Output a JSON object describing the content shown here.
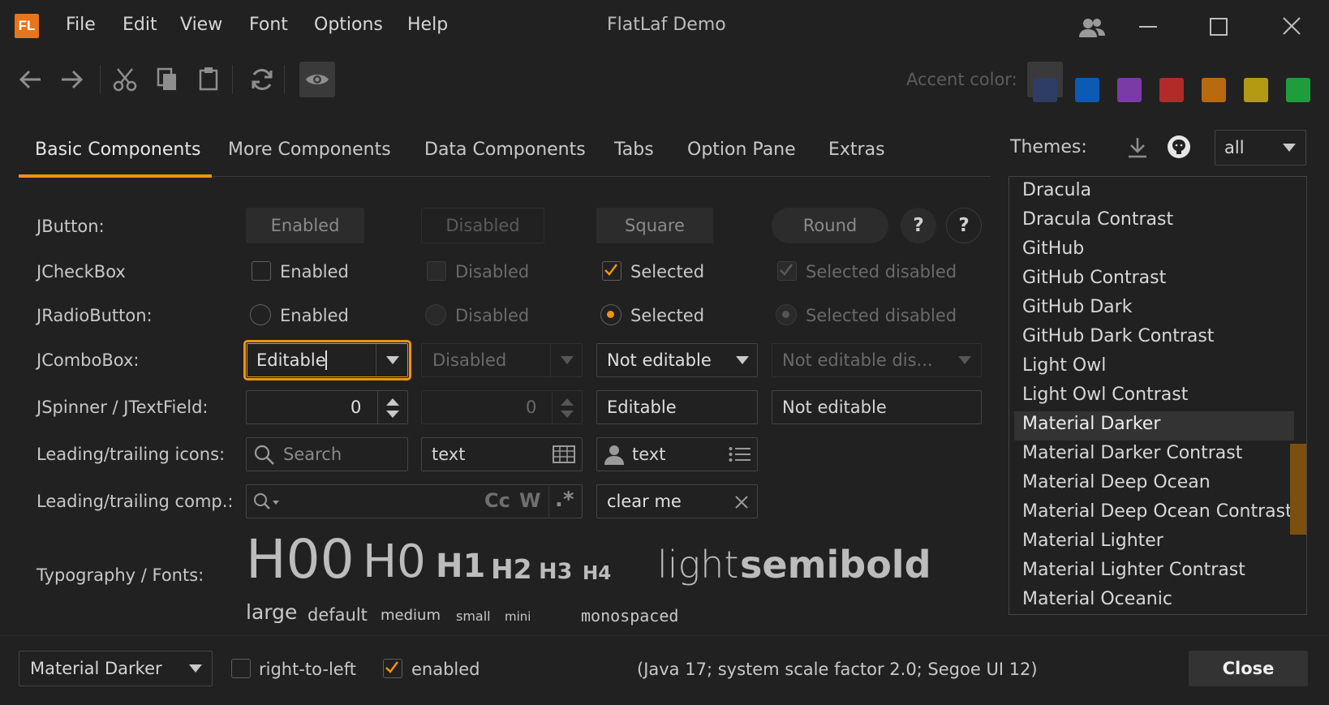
{
  "title_bar": {
    "app_title": "FlatLaf Demo",
    "logo_text": "FL"
  },
  "menu": {
    "file": "File",
    "edit": "Edit",
    "view": "View",
    "font": "Font",
    "options": "Options",
    "help": "Help"
  },
  "toolbar": {
    "accent_label": "Accent color:",
    "accent_colors": [
      "#2e3d63",
      "#0b5bb5",
      "#7b3ba6",
      "#b22a2a",
      "#b86a10",
      "#b39a13",
      "#1f9d3c"
    ]
  },
  "tabs": [
    "Basic Components",
    "More Components",
    "Data Components",
    "Tabs",
    "Option Pane",
    "Extras"
  ],
  "rows": {
    "jbutton": {
      "label": "JButton:",
      "enabled": "Enabled",
      "disabled": "Disabled",
      "square": "Square",
      "round": "Round",
      "help": "?"
    },
    "jcheckbox": {
      "label": "JCheckBox",
      "enabled": "Enabled",
      "disabled": "Disabled",
      "selected": "Selected",
      "selected_disabled": "Selected disabled"
    },
    "jradio": {
      "label": "JRadioButton:",
      "enabled": "Enabled",
      "disabled": "Disabled",
      "selected": "Selected",
      "selected_disabled": "Selected disabled"
    },
    "jcombo": {
      "label": "JComboBox:",
      "editable": "Editable",
      "disabled": "Disabled",
      "not_editable": "Not editable",
      "not_editable_dis": "Not editable dis..."
    },
    "jspinner": {
      "label": "JSpinner / JTextField:",
      "value": "0",
      "value_disabled": "0",
      "editable": "Editable",
      "not_editable": "Not editable"
    },
    "icons": {
      "label": "Leading/trailing icons:",
      "search_placeholder": "Search",
      "text1": "text",
      "text2": "text"
    },
    "comps": {
      "label": "Leading/trailing comp.:",
      "cc": "Cc",
      "w": "W",
      "regex": ".*",
      "clear_me": "clear me"
    },
    "typography": {
      "label": "Typography / Fonts:",
      "h00": "H00",
      "h0": "H0",
      "h1": "H1",
      "h2": "H2",
      "h3": "H3",
      "h4": "H4",
      "light": "light",
      "semibold": "semibold",
      "large": "large",
      "default": "default",
      "medium": "medium",
      "small": "small",
      "mini": "mini",
      "monospaced": "monospaced"
    }
  },
  "themes": {
    "label": "Themes:",
    "filter": "all",
    "items": [
      "Dracula",
      "Dracula Contrast",
      "GitHub",
      "GitHub Contrast",
      "GitHub Dark",
      "GitHub Dark Contrast",
      "Light Owl",
      "Light Owl Contrast",
      "Material Darker",
      "Material Darker Contrast",
      "Material Deep Ocean",
      "Material Deep Ocean Contrast",
      "Material Lighter",
      "Material Lighter Contrast",
      "Material Oceanic"
    ],
    "selected": "Material Darker"
  },
  "bottom": {
    "theme_combo": "Material Darker",
    "rtl": "right-to-left",
    "enabled": "enabled",
    "info": "(Java 17;  system scale factor 2.0; Segoe UI 12)",
    "close": "Close"
  },
  "colors": {
    "accent": "#f0930f",
    "background": "#212121"
  }
}
